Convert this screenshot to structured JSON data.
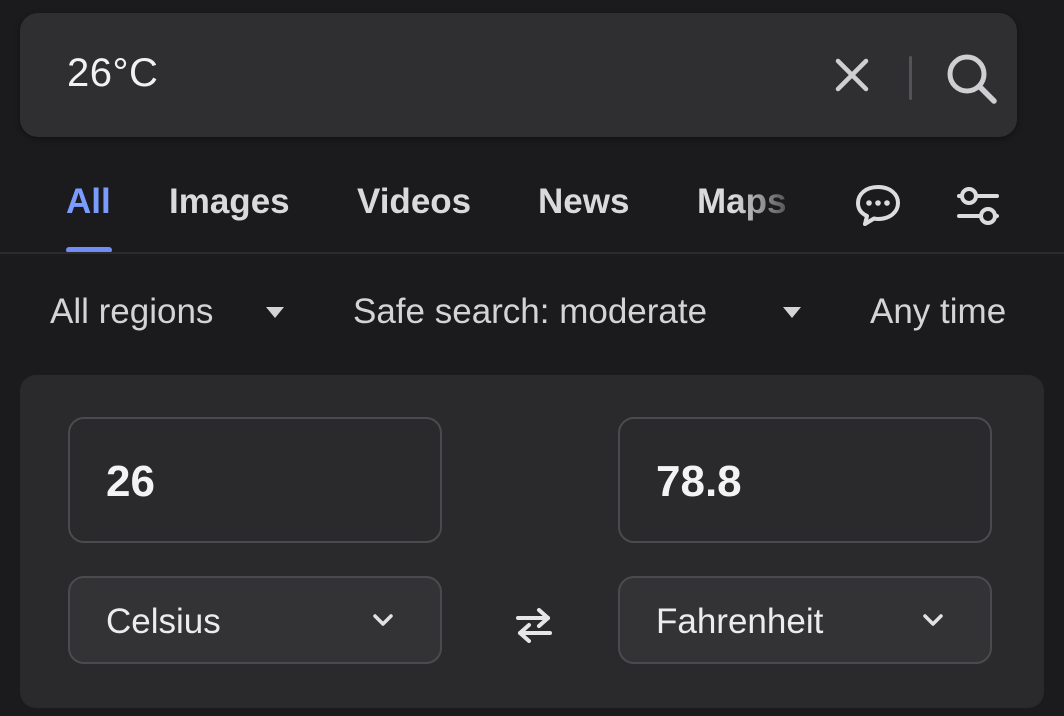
{
  "search": {
    "query": "26°C",
    "clear_icon": "close-icon",
    "search_icon": "search-icon"
  },
  "tabs": [
    {
      "label": "All",
      "active": true
    },
    {
      "label": "Images",
      "active": false
    },
    {
      "label": "Videos",
      "active": false
    },
    {
      "label": "News",
      "active": false
    },
    {
      "label": "Maps",
      "active": false
    }
  ],
  "tab_icons": [
    "chat-icon",
    "settings-sliders-icon"
  ],
  "filters": {
    "region": "All regions",
    "safe_search": "Safe search: moderate",
    "time": "Any time"
  },
  "converter": {
    "from_value": "26",
    "to_value": "78.8",
    "from_unit": "Celsius",
    "to_unit": "Fahrenheit",
    "swap_icon": "swap-arrows-icon"
  },
  "colors": {
    "background": "#1b1b1d",
    "accent": "#7b9cff",
    "card": "#2a2a2c"
  }
}
